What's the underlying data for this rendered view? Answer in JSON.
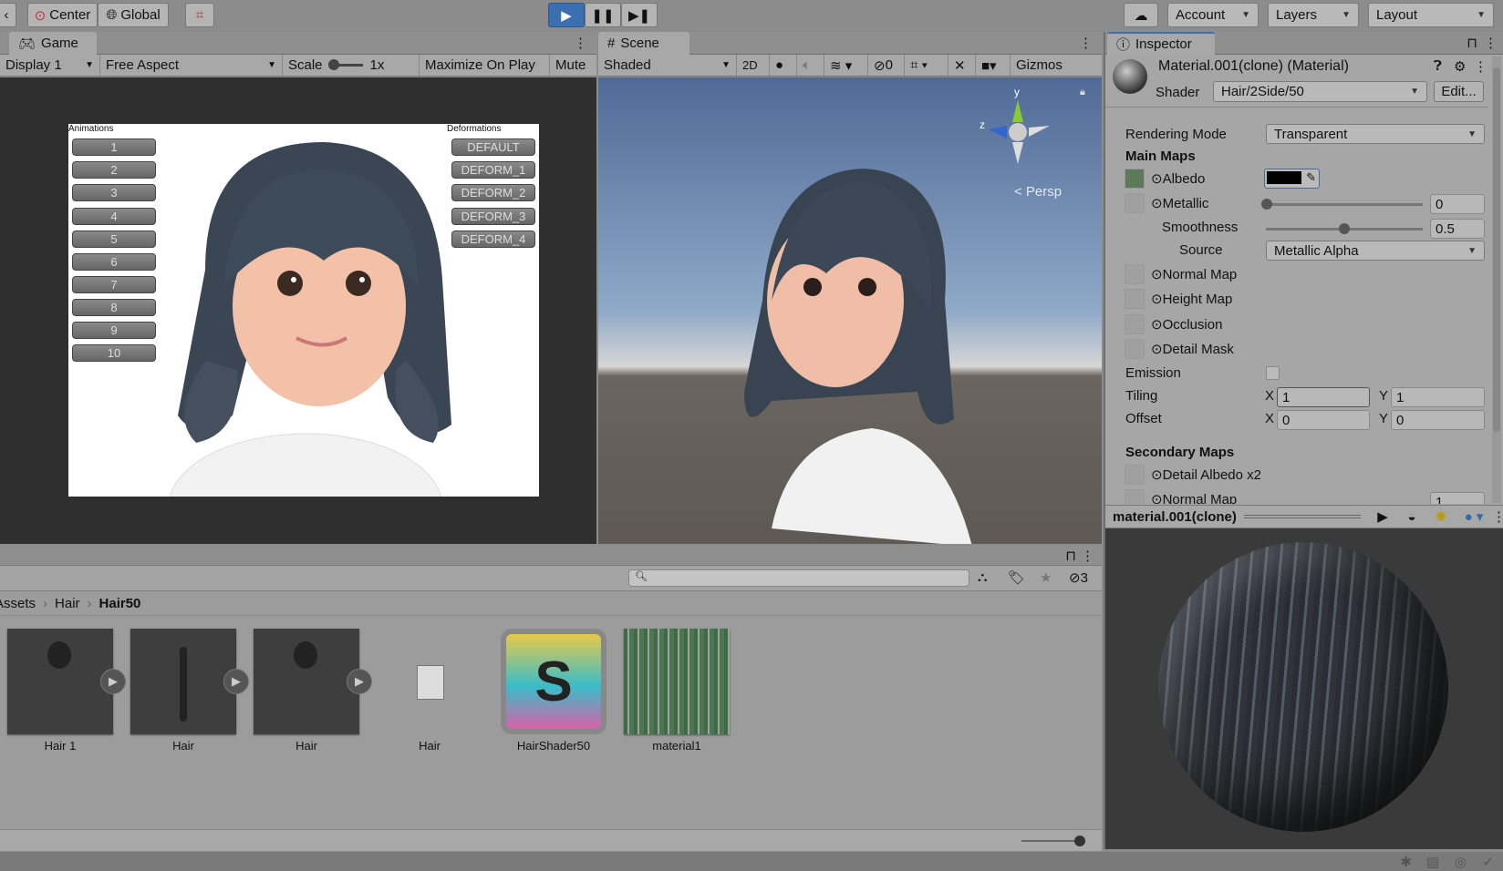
{
  "toolbar": {
    "center": "Center",
    "global": "Global",
    "account": "Account",
    "layers": "Layers",
    "layout": "Layout"
  },
  "game": {
    "tab": "Game",
    "display": "Display 1",
    "aspect": "Free Aspect",
    "scale_label": "Scale",
    "scale_value": "1x",
    "maximize": "Maximize On Play",
    "mute": "Mute",
    "animations_label": "Animations",
    "deformations_label": "Deformations",
    "animations": [
      "1",
      "2",
      "3",
      "4",
      "5",
      "6",
      "7",
      "8",
      "9",
      "10"
    ],
    "deformations": [
      "DEFAULT",
      "DEFORM_1",
      "DEFORM_2",
      "DEFORM_3",
      "DEFORM_4"
    ]
  },
  "scene": {
    "tab": "Scene",
    "shading": "Shaded",
    "mode2d": "2D",
    "hidden_count": "0",
    "gizmos": "Gizmos",
    "persp": "< Persp",
    "axis_y": "y",
    "axis_z": "z"
  },
  "inspector": {
    "tab": "Inspector",
    "title": "Material.001(clone) (Material)",
    "shader_label": "Shader",
    "shader": "Hair/2Side/50",
    "edit": "Edit...",
    "rendering_mode_label": "Rendering Mode",
    "rendering_mode": "Transparent",
    "main_maps": "Main Maps",
    "albedo": "Albedo",
    "albedo_color": "#000000",
    "metallic": "Metallic",
    "metallic_value": "0",
    "smoothness": "Smoothness",
    "smoothness_value": "0.5",
    "smoothness_fraction": 0.5,
    "source_label": "Source",
    "source": "Metallic Alpha",
    "normal_map": "Normal Map",
    "height_map": "Height Map",
    "occlusion": "Occlusion",
    "detail_mask": "Detail Mask",
    "emission": "Emission",
    "tiling": "Tiling",
    "offset": "Offset",
    "x": "X",
    "y": "Y",
    "tiling_x": "1",
    "tiling_y": "1",
    "offset_x": "0",
    "offset_y": "0",
    "secondary_maps": "Secondary Maps",
    "detail_albedo": "Detail Albedo x2",
    "normal_map2": "Normal Map",
    "normal_map2_value": "1",
    "preview_name": "material.001(clone)"
  },
  "project": {
    "hidden_count": "3",
    "breadcrumb": [
      "Assets",
      "Hair",
      "Hair50"
    ],
    "assets": [
      {
        "name": "Hair 1"
      },
      {
        "name": "Hair"
      },
      {
        "name": "Hair"
      },
      {
        "name": "Hair"
      },
      {
        "name": "HairShader50"
      },
      {
        "name": "material1"
      }
    ]
  },
  "colors": {
    "play_active": "#3a6fb0"
  }
}
